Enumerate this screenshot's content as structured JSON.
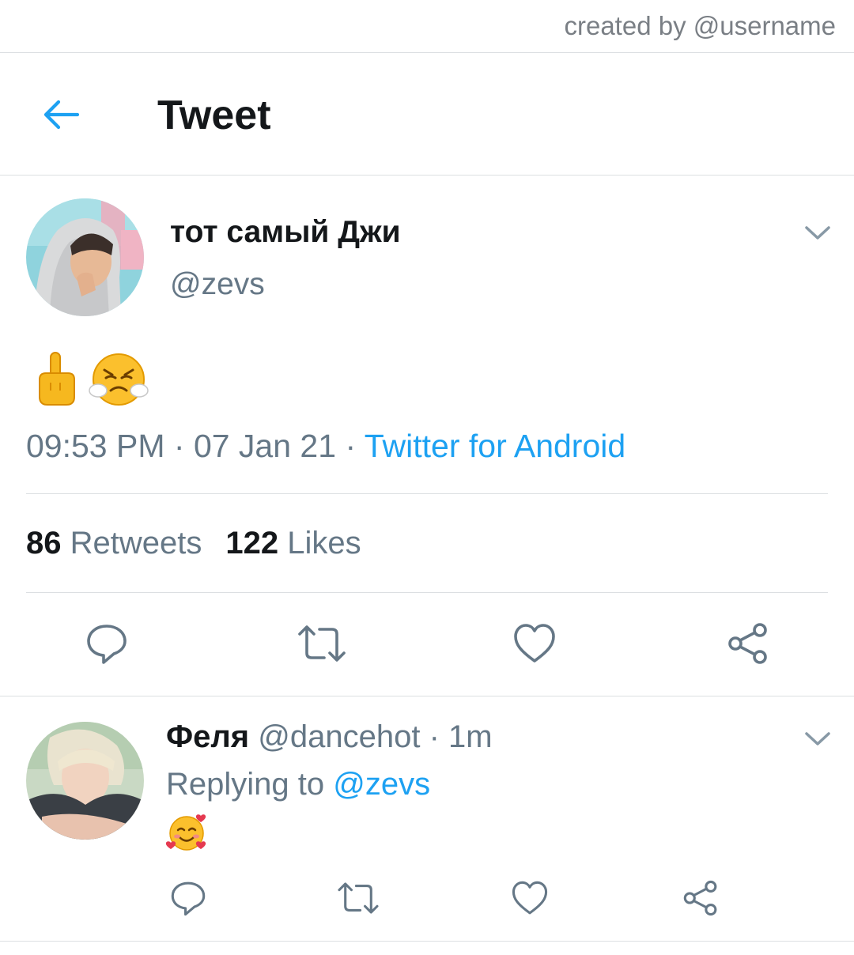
{
  "watermark": "created by @username",
  "header": {
    "title": "Tweet",
    "back_icon": "arrow-left-icon"
  },
  "tweet": {
    "author_name": "тот самый Джи",
    "author_handle": "@zevs",
    "content_emojis": [
      "middle-finger-emoji",
      "face-with-steam-emoji"
    ],
    "time": "09:53 PM",
    "sep1": " · ",
    "date": "07 Jan 21",
    "sep2": " · ",
    "source": "Twitter for Android",
    "retweets_count": "86",
    "retweets_label": "Retweets",
    "likes_count": "122",
    "likes_label": "Likes",
    "actions": [
      "reply-icon",
      "retweet-icon",
      "like-icon",
      "share-icon"
    ]
  },
  "reply": {
    "author_name": "Феля",
    "author_handle": "@dancehot",
    "sep": " · ",
    "time": "1m",
    "replying_prefix": "Replying to",
    "replying_to": "@zevs",
    "content_emoji": "smiling-face-with-hearts-emoji",
    "actions": [
      "reply-icon",
      "retweet-icon",
      "like-icon",
      "share-icon"
    ]
  },
  "colors": {
    "accent": "#1da1f2",
    "secondary_text": "#657786",
    "icon": "#657786",
    "divider": "#dcdfe2"
  }
}
